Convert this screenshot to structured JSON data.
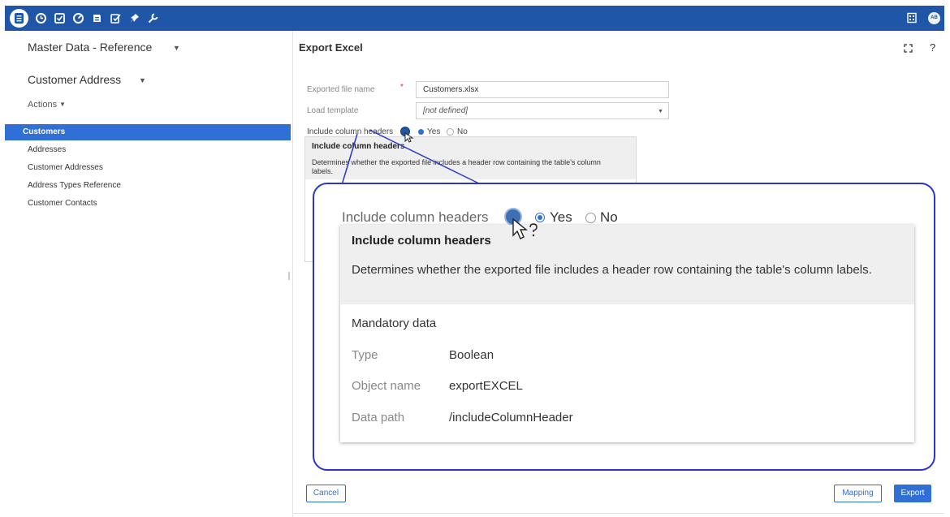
{
  "toolbar": {
    "icons": [
      "document-list-icon",
      "clock-icon",
      "checkbox-icon",
      "gauge-icon",
      "stack-icon",
      "edit-check-icon",
      "pin-icon",
      "wrench-icon"
    ],
    "right_icon": "building-icon",
    "avatar_initials": "AB",
    "accent": "#1f56a8"
  },
  "left_panel": {
    "title": "Master Data - Reference",
    "subtitle": "Customer Address",
    "actions_label": "Actions",
    "items": [
      {
        "label": "Customers",
        "active": true
      },
      {
        "label": "Addresses",
        "active": false
      },
      {
        "label": "Customer Addresses",
        "active": false
      },
      {
        "label": "Address Types Reference",
        "active": false
      },
      {
        "label": "Customer Contacts",
        "active": false
      }
    ]
  },
  "main": {
    "title": "Export Excel",
    "help_label": "?",
    "form": {
      "file_name_label": "Exported file name",
      "required_mark": "*",
      "file_name_value": "Customers.xlsx",
      "template_label": "Load template",
      "template_value": "[not defined]",
      "headers_label": "Include column headers",
      "yes_label": "Yes",
      "no_label": "No",
      "selected": "Yes"
    },
    "small_tooltip": {
      "title": "Include column headers",
      "description": "Determines whether the exported file includes a header row containing the table's column labels."
    },
    "buttons": {
      "cancel": "Cancel",
      "mapping": "Mapping",
      "export": "Export"
    }
  },
  "zoom": {
    "label": "Include column headers",
    "yes_label": "Yes",
    "no_label": "No",
    "tooltip": {
      "title": "Include column headers",
      "description": "Determines whether the exported file includes a header row containing the table's column labels.",
      "mandatory": "Mandatory data",
      "rows": [
        {
          "key": "Type",
          "value": "Boolean"
        },
        {
          "key": "Object name",
          "value": "exportEXCEL"
        },
        {
          "key": "Data path",
          "value": "/includeColumnHeader"
        }
      ]
    }
  }
}
